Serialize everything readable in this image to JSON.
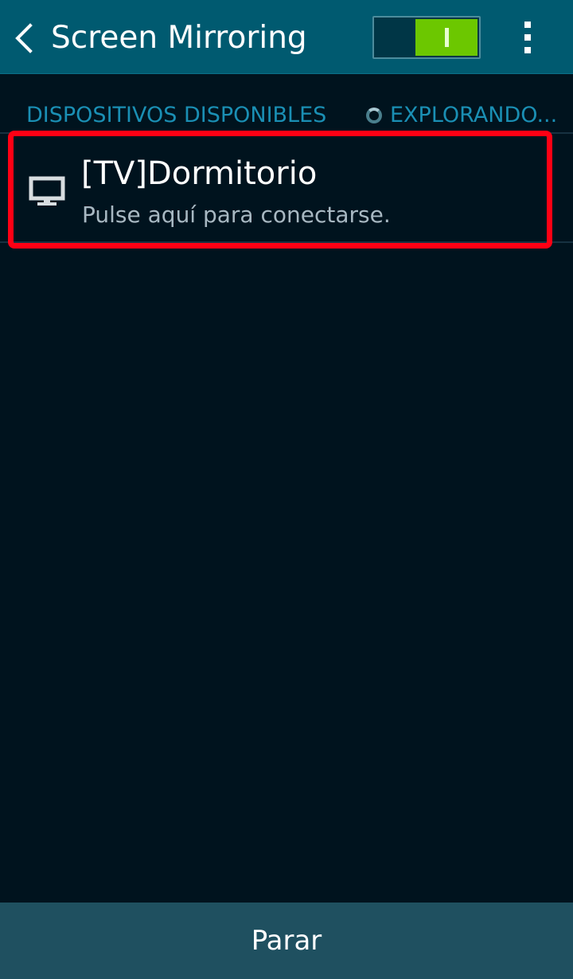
{
  "app_bar": {
    "title": "Screen Mirroring",
    "back_icon": "chevron-left-icon",
    "switch_on": true,
    "switch_color": "#6cc700",
    "more_icon": "more-vertical-icon"
  },
  "devices_section": {
    "header": "DISPOSITIVOS DISPONIBLES",
    "scan_status": "EXPLORANDO...",
    "devices": [
      {
        "name": "[TV]Dormitorio",
        "subtitle": "Pulse aquí para conectarse.",
        "icon": "monitor-icon"
      }
    ]
  },
  "bottom_bar": {
    "stop_label": "Parar"
  },
  "colors": {
    "app_bar_bg": "#005a70",
    "background": "#00131e",
    "accent_text": "#1a8fb4",
    "highlight": "#ff0014",
    "bottom_bar_bg": "#1f5060"
  }
}
